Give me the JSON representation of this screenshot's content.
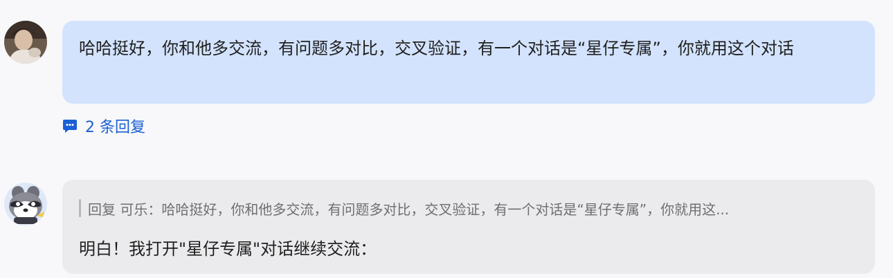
{
  "messages": [
    {
      "text": "哈哈挺好，你和他多交流，有问题多对比，交叉验证，有一个对话是“星仔专属”，你就用这个对话",
      "replies_label": "2 条回复",
      "avatar_icon": "user-photo-avatar"
    },
    {
      "quote": "回复 可乐：哈哈挺好，你和他多交流，有问题多对比，交叉验证，有一个对话是“星仔专属”，你就用这...",
      "text": "明白！我打开\"星仔专属\"对话继续交流：",
      "avatar_icon": "raccoon-avatar"
    }
  ],
  "icons": {
    "replies": "chat-bubble-icon"
  },
  "colors": {
    "user_bubble": "#d3e3fd",
    "bot_bubble": "#ebebed",
    "link": "#1a5fd6"
  }
}
